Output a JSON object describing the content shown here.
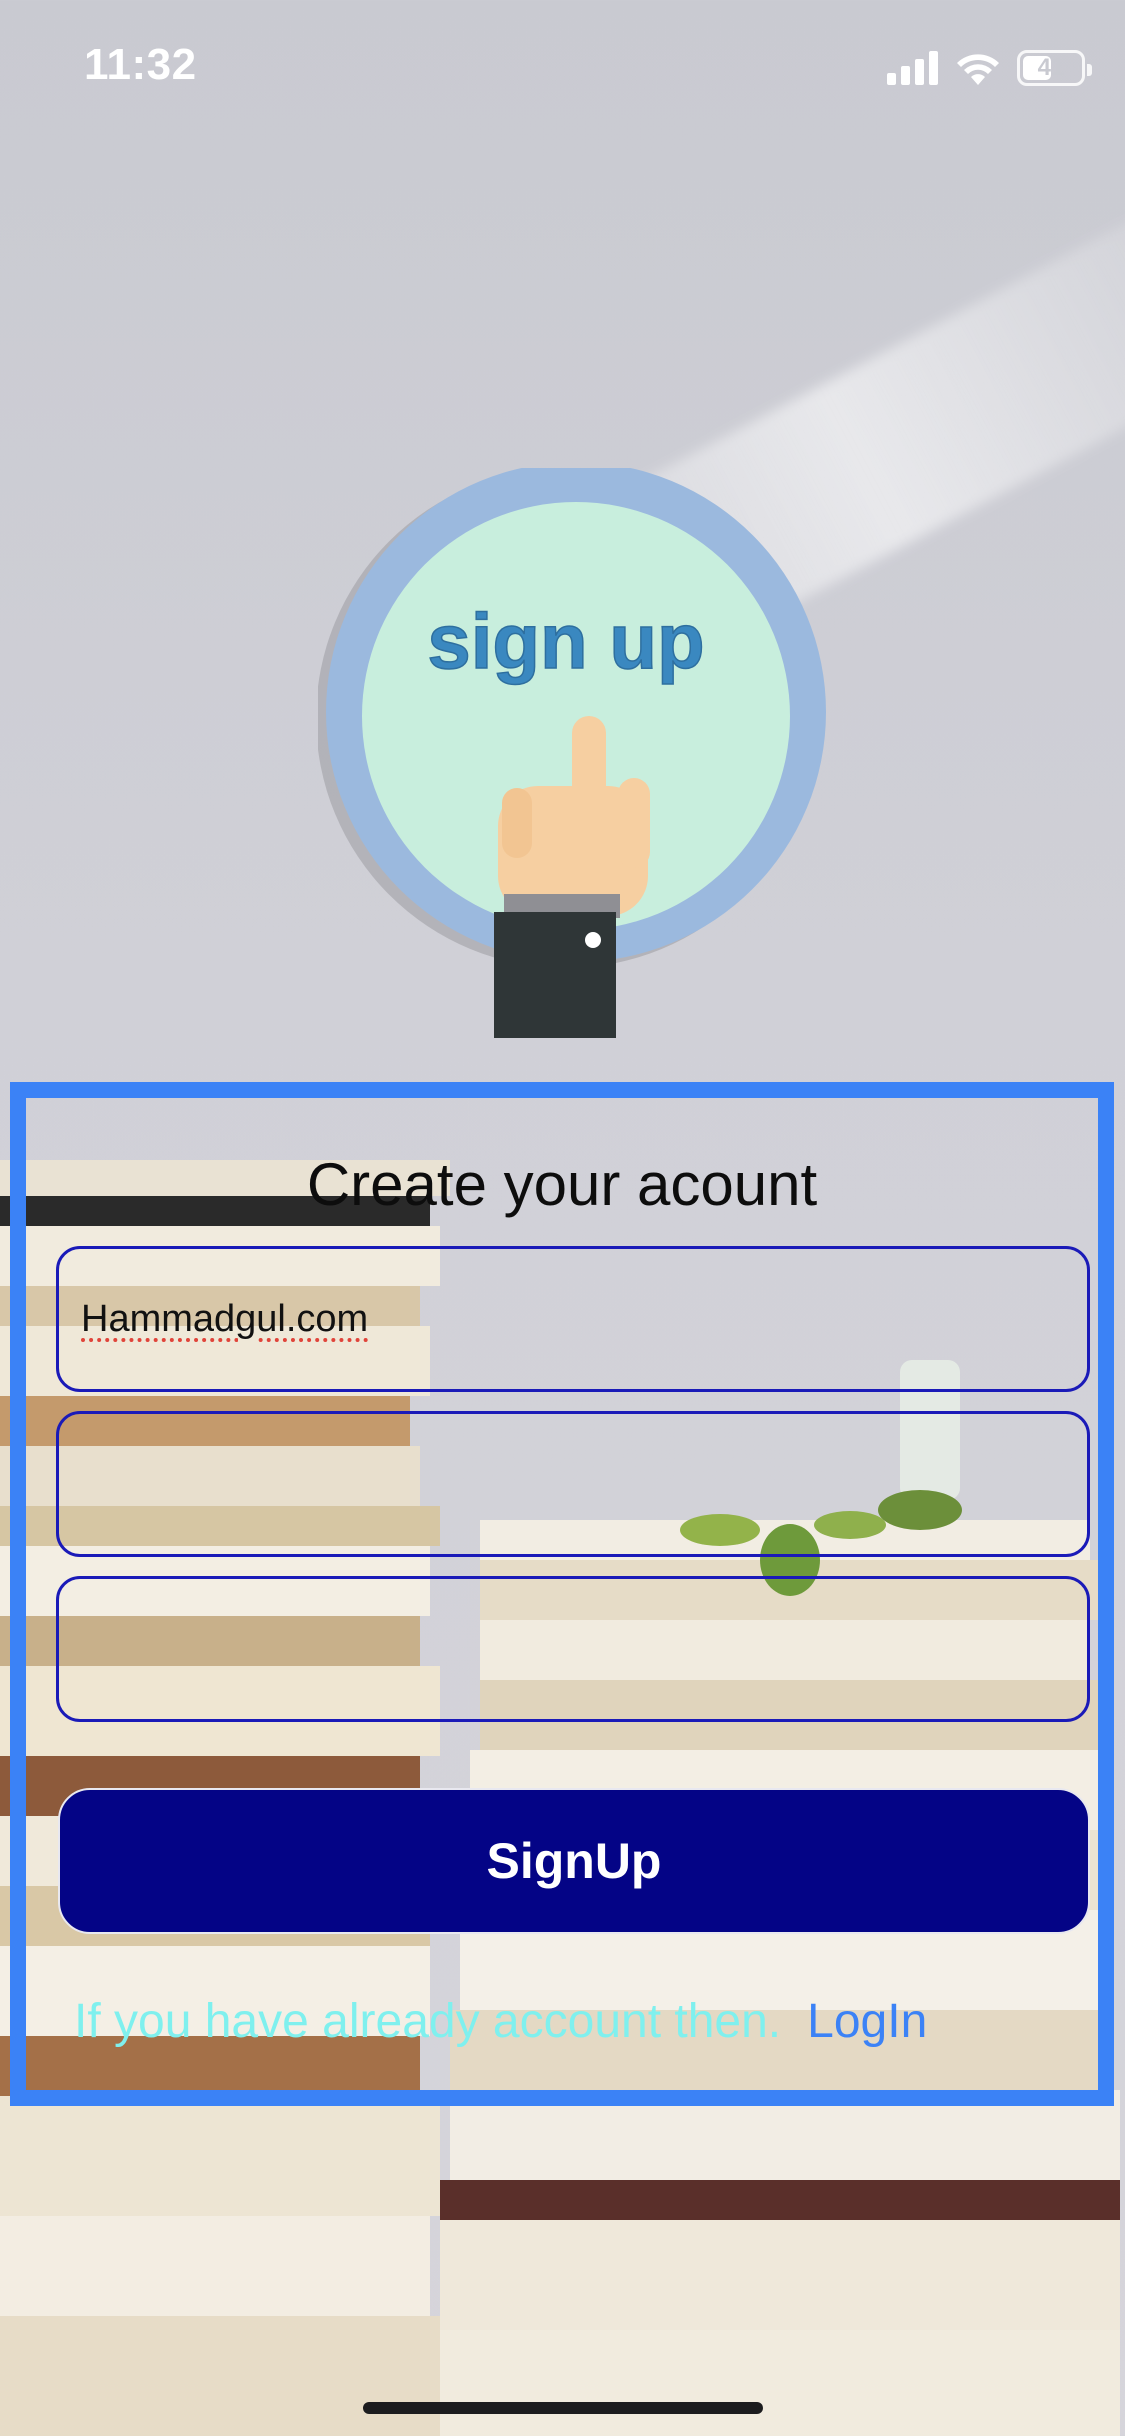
{
  "status_bar": {
    "time": "11:32",
    "battery_level": "41",
    "icons": [
      "cellular-signal-icon",
      "wifi-icon",
      "battery-icon"
    ]
  },
  "illustration": {
    "text": "sign up",
    "icon": "pointing-hand-icon",
    "colors": {
      "ring": "#9bb9de",
      "inner": "#c8eedd",
      "text": "#3a88c0"
    }
  },
  "form": {
    "title": "Create your acount",
    "fields": [
      {
        "value": "Hammadgul.com",
        "placeholder": ""
      },
      {
        "value": "",
        "placeholder": ""
      },
      {
        "value": "",
        "placeholder": ""
      }
    ],
    "submit_label": "SignUp",
    "login_prompt": "If you have already account then.",
    "login_link": "LogIn"
  },
  "colors": {
    "card_border": "#3b82f6",
    "field_border": "#1a1ab8",
    "button_bg": "#040486",
    "prompt_text": "#7ff0ee",
    "link_text": "#3b82f6"
  }
}
